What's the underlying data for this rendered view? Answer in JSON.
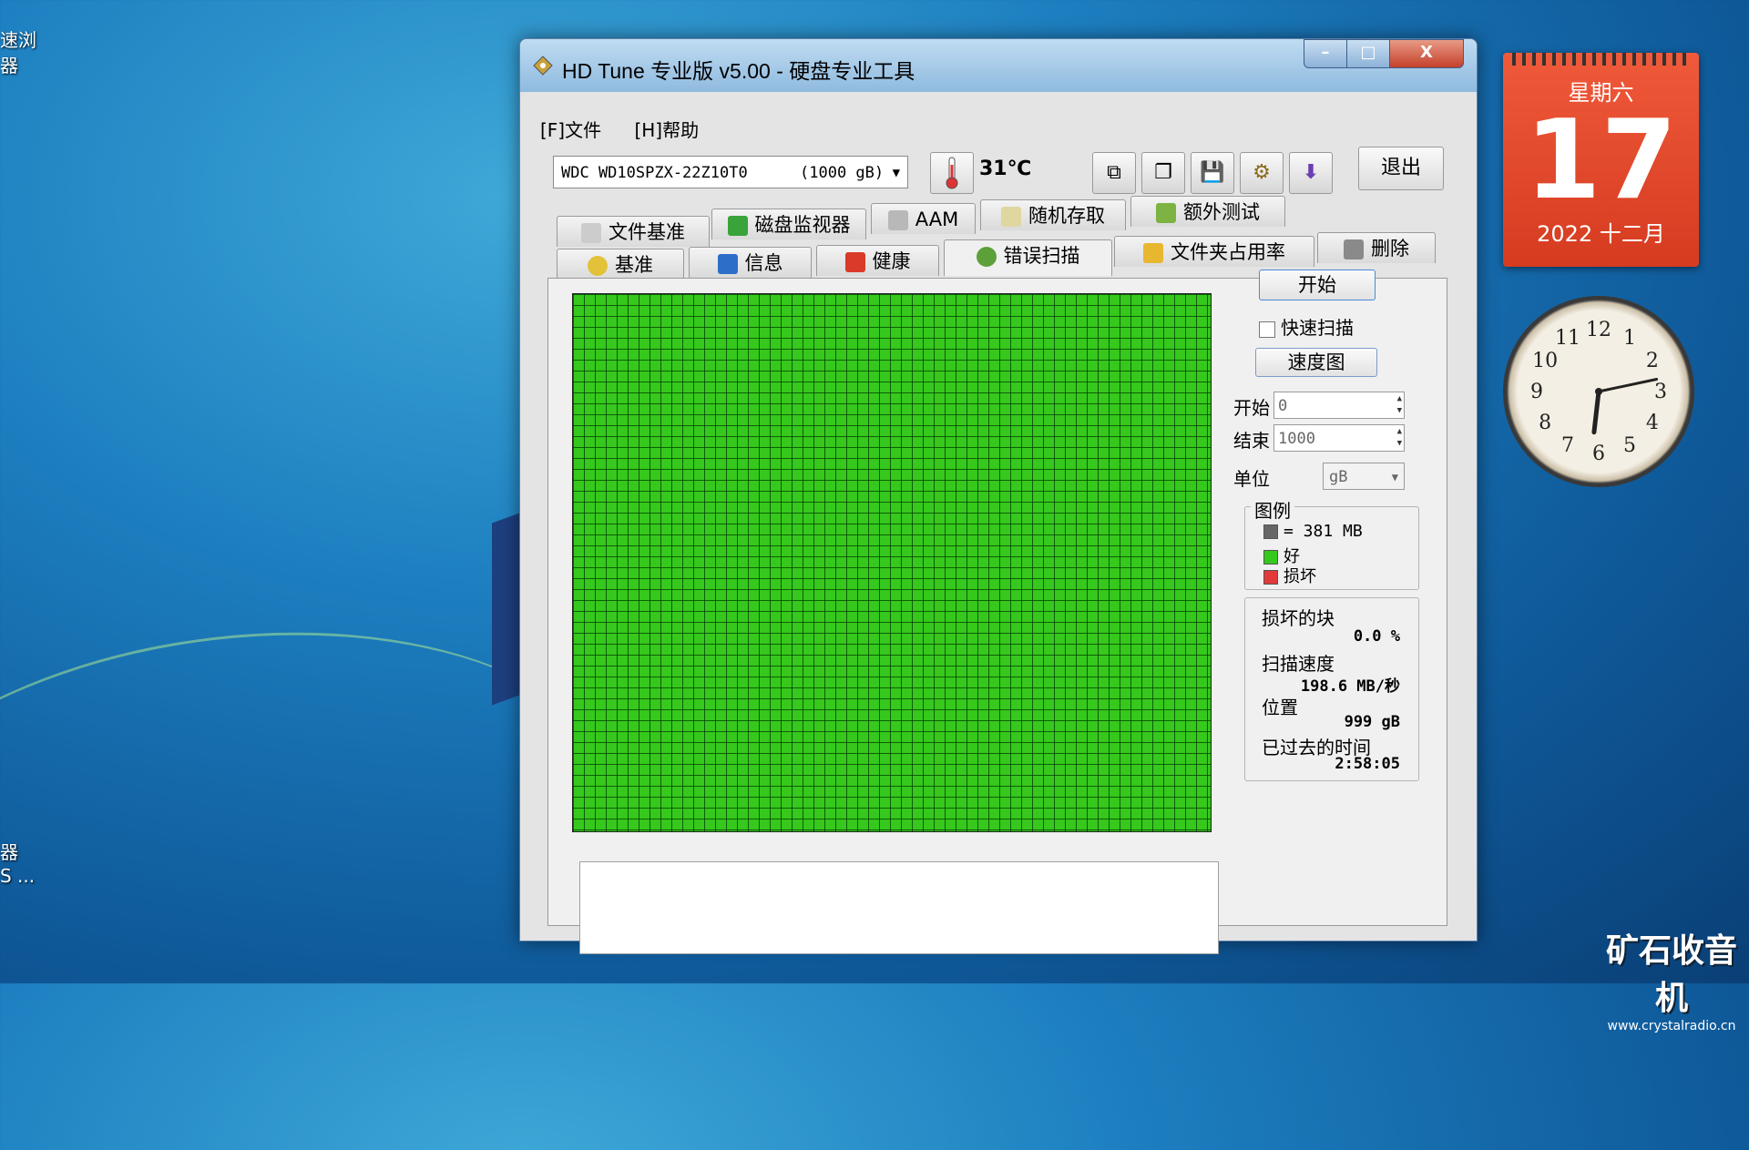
{
  "desktop": {
    "left_labels": [
      "速浏",
      "器"
    ],
    "bottom_labels": [
      "器",
      "S ..."
    ]
  },
  "window": {
    "title": "HD Tune 专业版 v5.00 - 硬盘专业工具",
    "controls": {
      "minimize": "–",
      "maximize": "□",
      "close": "X"
    }
  },
  "menu": {
    "file": "[F]文件",
    "help": "[H]帮助"
  },
  "toolbar": {
    "drive": "WDC WD10SPZX-22Z10T0",
    "drive_size": "(1000 gB)",
    "temperature": "31℃",
    "buttons": [
      "copy-icon",
      "copy-all-icon",
      "save-icon",
      "options-icon",
      "download-icon"
    ],
    "exit": "退出"
  },
  "tabs": {
    "row1": [
      "文件基准",
      "磁盘监视器",
      "AAM",
      "随机存取",
      "额外测试"
    ],
    "row2": [
      "基准",
      "信息",
      "健康",
      "错误扫描",
      "文件夹占用率",
      "删除"
    ],
    "active": "错误扫描"
  },
  "scan": {
    "map_color": "#36c81d",
    "start_button": "开始",
    "quick_scan": "快速扫描",
    "speed_map": "速度图",
    "start_label": "开始",
    "start_value": "0",
    "end_label": "结束",
    "end_value": "1000",
    "unit_label": "单位",
    "unit_value": "gB",
    "legend": {
      "title": "图例",
      "block_size": "= 381 MB",
      "good": "好",
      "damaged": "损坏",
      "block_color": "#666666",
      "good_color": "#36c81d",
      "damaged_color": "#e23a3a"
    },
    "stats": {
      "damaged_blocks_label": "损坏的块",
      "damaged_blocks_value": "0.0 %",
      "scan_speed_label": "扫描速度",
      "scan_speed_value": "198.6 MB/秒",
      "position_label": "位置",
      "position_value": "999 gB",
      "elapsed_label": "已过去的时间",
      "elapsed_value": "2:58:05"
    }
  },
  "calendar": {
    "weekday": "星期六",
    "day": "17",
    "month": "2022 十二月"
  },
  "clock": {
    "hour": 6,
    "minute": 13,
    "numerals": [
      "12",
      "1",
      "2",
      "3",
      "4",
      "5",
      "6",
      "7",
      "8",
      "9",
      "10",
      "11"
    ]
  },
  "watermark": {
    "line1": "矿石收音机",
    "line2": "www.crystalradio.cn"
  }
}
